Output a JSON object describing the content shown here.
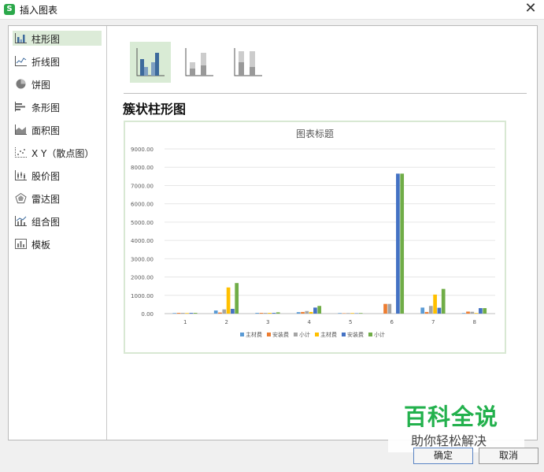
{
  "window": {
    "title": "插入图表",
    "app_icon_letter": "S",
    "close_glyph": "✕"
  },
  "sidebar": {
    "items": [
      {
        "label": "柱形图",
        "icon": "column-chart-icon",
        "selected": true
      },
      {
        "label": "折线图",
        "icon": "line-chart-icon"
      },
      {
        "label": "饼图",
        "icon": "pie-chart-icon"
      },
      {
        "label": "条形图",
        "icon": "bar-chart-icon"
      },
      {
        "label": "面积图",
        "icon": "area-chart-icon"
      },
      {
        "label": "X Y（散点图）",
        "icon": "scatter-chart-icon"
      },
      {
        "label": "股价图",
        "icon": "stock-chart-icon"
      },
      {
        "label": "雷达图",
        "icon": "radar-chart-icon"
      },
      {
        "label": "组合图",
        "icon": "combo-chart-icon"
      },
      {
        "label": "模板",
        "icon": "template-icon"
      }
    ]
  },
  "chart_types": [
    {
      "name": "clustered-column",
      "selected": true
    },
    {
      "name": "stacked-column"
    },
    {
      "name": "percent-stacked-column"
    }
  ],
  "subtype_title": "簇状柱形图",
  "chart_data": {
    "type": "bar",
    "title": "图表标题",
    "categories": [
      "1",
      "2",
      "3",
      "4",
      "5",
      "6",
      "7",
      "8"
    ],
    "ylim": [
      0,
      9000
    ],
    "yticks": [
      "0.00",
      "1000.00",
      "2000.00",
      "3000.00",
      "4000.00",
      "5000.00",
      "6000.00",
      "7000.00",
      "8000.00",
      "9000.00"
    ],
    "grid": true,
    "legend_position": "bottom",
    "series": [
      {
        "name": "主材费",
        "color": "#5b9bd5",
        "values": [
          30,
          170,
          40,
          80,
          30,
          0,
          330,
          30
        ]
      },
      {
        "name": "安装费",
        "color": "#ed7d31",
        "values": [
          40,
          60,
          40,
          90,
          20,
          530,
          90,
          110
        ]
      },
      {
        "name": "小计",
        "color": "#a5a5a5",
        "values": [
          40,
          230,
          40,
          140,
          30,
          530,
          420,
          100
        ]
      },
      {
        "name": "主材费",
        "color": "#ffc000",
        "values": [
          30,
          1430,
          40,
          90,
          30,
          0,
          1040,
          30
        ]
      },
      {
        "name": "安装费",
        "color": "#4472c4",
        "values": [
          40,
          260,
          40,
          330,
          20,
          7650,
          320,
          300
        ]
      },
      {
        "name": "小计",
        "color": "#70ad47",
        "values": [
          40,
          1670,
          70,
          420,
          30,
          7650,
          1350,
          300
        ]
      }
    ]
  },
  "watermark": {
    "line1": "百科全说",
    "line2": "助你轻松解决"
  },
  "buttons": {
    "ok": "确定",
    "cancel": "取消"
  }
}
